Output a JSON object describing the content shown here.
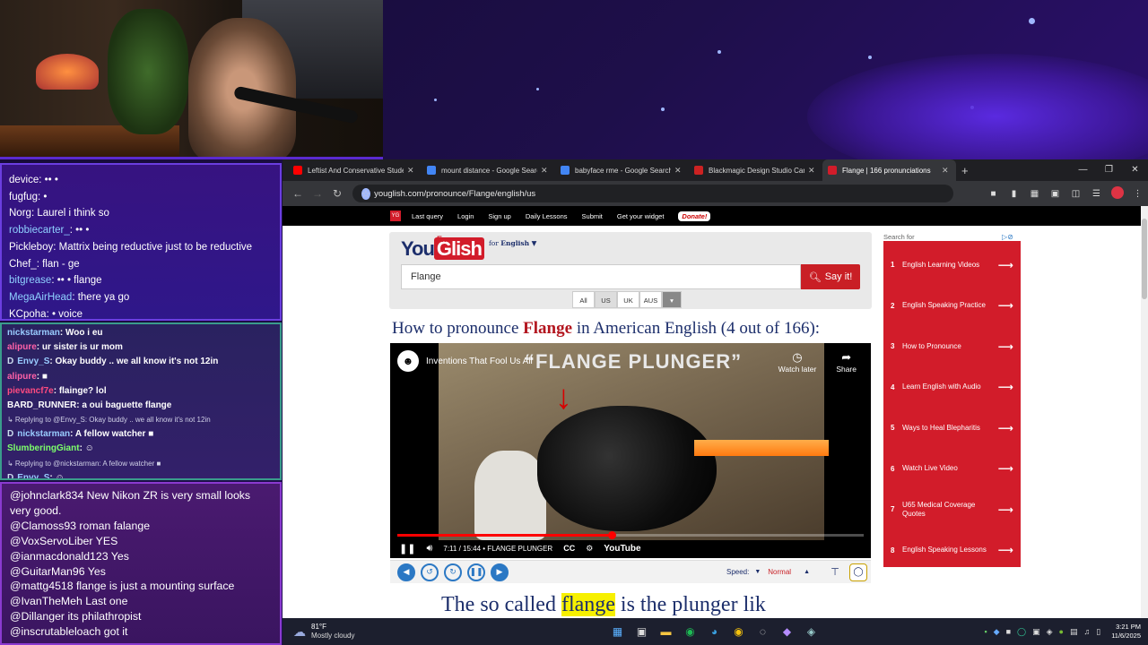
{
  "chat_top": [
    {
      "user": "device",
      "text": ": •• •"
    },
    {
      "user": "fugfug",
      "text": ": •"
    },
    {
      "user": "Norg",
      "text": ": Laurel i think so"
    },
    {
      "user": "robbiecarter_",
      "text": ": •• •",
      "cyan": true
    },
    {
      "user": "Pickleboy",
      "text": ": Mattrix being reductive just to be reductive"
    },
    {
      "user": "Chef_",
      "text": ": flan - ge"
    },
    {
      "user": "bitgrease",
      "text": ": •• • flange",
      "cyan": true
    },
    {
      "user": "MegaAirHead",
      "text": ": there ya go",
      "cyan": true
    },
    {
      "user": "KCpoha",
      "text": ": • voice"
    }
  ],
  "chat_middle": [
    {
      "user": "nickstarman",
      "text": "Woo i eu",
      "cls": "u2",
      "badge": ""
    },
    {
      "user": "alipure",
      "text": "ur sister is ur mom",
      "cls": "u1",
      "badge": ""
    },
    {
      "user": "Envy_S",
      "text": "Okay buddy .. we all know it's not 12in",
      "cls": "u2",
      "badge": "D"
    },
    {
      "user": "alipure",
      "text": "■",
      "cls": "u1",
      "badge": ""
    },
    {
      "user": "pievancf7e",
      "text": "flainge? lol",
      "cls": "u3",
      "badge": ""
    },
    {
      "user": "BARD_RUNNER",
      "text": "a oui baguette flange",
      "cls": "u5",
      "badge": ""
    },
    {
      "reply": "↳ Replying to @Envy_S: Okay buddy .. we all know it's not 12in"
    },
    {
      "user": "nickstarman",
      "text": "A fellow watcher ■",
      "cls": "u2",
      "badge": "D"
    },
    {
      "user": "SlumberingGiant",
      "text": "☺",
      "cls": "u4",
      "badge": ""
    },
    {
      "reply": "↳ Replying to @nickstarman: A fellow watcher ■"
    },
    {
      "user": "Envy_S",
      "text": "☺",
      "cls": "u2",
      "badge": "D"
    }
  ],
  "chat_bottom": [
    {
      "user": "@johnclark834",
      "text": "New Nikon ZR is very small looks very good."
    },
    {
      "user": "@Clamoss93",
      "text": "roman falange"
    },
    {
      "user": "@VoxServoLiber",
      "text": "YES"
    },
    {
      "user": "@ianmacdonald123",
      "text": "Yes"
    },
    {
      "user": "@GuitarMan96",
      "text": "Yes"
    },
    {
      "user": "@mattg4518",
      "text": "flange is just a mounting surface"
    },
    {
      "user": "@IvanTheMeh",
      "text": "Last one"
    },
    {
      "user": "@Dillanger",
      "text": "its philathropist"
    },
    {
      "user": "@inscrutableloach",
      "text": "got it"
    }
  ],
  "browser": {
    "tabs": [
      {
        "title": "Leftist And Conservative Studen",
        "color": "#ff0000",
        "active": false
      },
      {
        "title": "mount distance - Google Search",
        "color": "#4285f4",
        "active": false
      },
      {
        "title": "babyface rme - Google Search",
        "color": "#4285f4",
        "active": false
      },
      {
        "title": "Blackmagic Design Studio Came",
        "color": "#c22",
        "active": false
      },
      {
        "title": "Flange | 166 pronunciations",
        "color": "#d21c2a",
        "active": true
      }
    ],
    "url": "youglish.com/pronounce/Flange/english/us"
  },
  "youglish": {
    "nav": [
      "Last query",
      "Login",
      "Sign up",
      "Daily Lessons",
      "Submit",
      "Get your widget"
    ],
    "donate": "Donate!",
    "logo_you": "You",
    "logo_glish": "Glish",
    "logo_en": "En",
    "for_label": "for",
    "lang": "English ▼",
    "search_value": "Flange",
    "say_it": "Say it!",
    "accents": [
      "All",
      "US",
      "UK",
      "AUS"
    ],
    "heading_pre": "How to pronounce ",
    "heading_word": "Flange",
    "heading_post": " in American English (4 out of 166):",
    "video": {
      "title": "Inventions That Fool Us All",
      "overlay": "“FLANGE PLUNGER”",
      "watch_later": "Watch later",
      "share": "Share",
      "time": "7:11 / 15:44",
      "chapter": "• FLANGE PLUNGER",
      "youtube": "YouTube",
      "progress": 0.46
    },
    "speed_label": "Speed:",
    "speed_value": "Normal",
    "caption_pre": "The so called ",
    "caption_word": "flange",
    "caption_post": " is the plunger lik",
    "ads_label": "Search for",
    "ads": [
      {
        "n": "1",
        "t": "English Learning Videos"
      },
      {
        "n": "2",
        "t": "English Speaking Practice"
      },
      {
        "n": "3",
        "t": "How to Pronounce"
      },
      {
        "n": "4",
        "t": "Learn English with Audio"
      },
      {
        "n": "5",
        "t": "Ways to Heal Blepharitis"
      },
      {
        "n": "6",
        "t": "Watch Live Video"
      },
      {
        "n": "7",
        "t": "U65 Medical Coverage Quotes"
      },
      {
        "n": "8",
        "t": "English Speaking Lessons"
      }
    ]
  },
  "taskbar": {
    "temp": "81°F",
    "condition": "Mostly cloudy",
    "time": "3:21 PM",
    "date": "11/6/2025"
  }
}
